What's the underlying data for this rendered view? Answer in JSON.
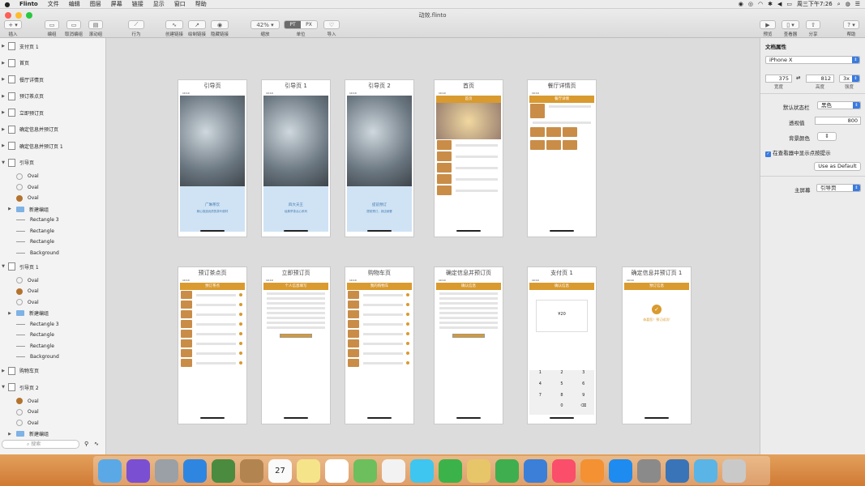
{
  "menubar": {
    "apple": "",
    "items": [
      "Flinto",
      "文件",
      "编辑",
      "图层",
      "屏幕",
      "链接",
      "显示",
      "窗口",
      "帮助"
    ],
    "clock": "周三下午7:26"
  },
  "window": {
    "title": "动效.flinto"
  },
  "toolbar": {
    "insert": "插入",
    "group": "编组",
    "ungroup": "取消编组",
    "scroll_group": "滚动组",
    "behavior": "行为",
    "create_link": "创建链接",
    "draw_link": "绘制链接",
    "hide_link": "隐藏链接",
    "zoom": "42%",
    "zoom_label": "缩放",
    "unit_pt": "PT",
    "unit_px": "PX",
    "unit_label": "单位",
    "import": "导入",
    "preview": "预览",
    "viewer": "查看器",
    "share": "分享",
    "help": "帮助"
  },
  "sidebar": {
    "screens_top": [
      "支付页 1",
      "首页",
      "餐厅详情页",
      "预订茶点页",
      "立即预订页",
      "确定信息并预订页",
      "确定信息并预订页 1"
    ],
    "guide": {
      "name": "引导页",
      "layers": [
        [
          "Oval",
          "oval-empty"
        ],
        [
          "Oval",
          "oval-empty"
        ],
        [
          "Oval",
          "oval-filled"
        ],
        [
          "新建编组",
          "group"
        ],
        [
          "Rectangle 3",
          "rect"
        ],
        [
          "Rectangle",
          "rect"
        ],
        [
          "Rectangle",
          "rect"
        ],
        [
          "Background",
          "rect"
        ]
      ]
    },
    "guide1": {
      "name": "引导页 1",
      "layers": [
        [
          "Oval",
          "oval-empty"
        ],
        [
          "Oval",
          "oval-filled"
        ],
        [
          "Oval",
          "oval-empty"
        ],
        [
          "新建编组",
          "group"
        ],
        [
          "Rectangle 3",
          "rect"
        ],
        [
          "Rectangle",
          "rect"
        ],
        [
          "Rectangle",
          "rect"
        ],
        [
          "Background",
          "rect"
        ]
      ]
    },
    "cart": "购物车页",
    "guide2": {
      "name": "引导页 2",
      "layers": [
        [
          "Oval",
          "oval-filled"
        ],
        [
          "Oval",
          "oval-empty"
        ],
        [
          "Oval",
          "oval-empty"
        ],
        [
          "新建编组",
          "group"
        ]
      ]
    },
    "search_placeholder": "搜索"
  },
  "frames": [
    {
      "title": "引导页",
      "kind": "guide",
      "caption": "广琳茶饮",
      "sub": "精心挑选优质的茶叶原材"
    },
    {
      "title": "引导页 1",
      "kind": "guide",
      "caption": "四大天王",
      "sub": "经典早茶点心系列"
    },
    {
      "title": "引导页 2",
      "kind": "guide",
      "caption": "提前预订",
      "sub": "提前预订，到店就餐"
    },
    {
      "title": "首页",
      "kind": "home",
      "header": "首页"
    },
    {
      "title": "餐厅详情页",
      "kind": "detail",
      "header": "餐厅详情"
    },
    {
      "title": "预订茶点页",
      "kind": "list",
      "header": "预订茶点"
    },
    {
      "title": "立即预订页",
      "kind": "form",
      "header": "个人信息填写"
    },
    {
      "title": "购物车页",
      "kind": "list",
      "header": "我的购物车"
    },
    {
      "title": "确定信息并预订页",
      "kind": "form",
      "header": "确认信息"
    },
    {
      "title": "支付页 1",
      "kind": "pay",
      "header": "确认信息",
      "amount": "¥20"
    },
    {
      "title": "确定信息并预订页 1",
      "kind": "done",
      "header": "预订信息",
      "msg": "恭喜您！预订成功!"
    }
  ],
  "inspector": {
    "section": "文档属性",
    "device": "iPhone X",
    "width": "375",
    "height": "812",
    "scale": "3x",
    "width_label": "宽度",
    "height_label": "高度",
    "scale_label": "强度",
    "status_bar_label": "默认状态栏",
    "status_bar": "黑色",
    "perspective_label": "透视值",
    "perspective": "800",
    "bg_color_label": "背景颜色",
    "touch_hint": "在查看器中显示点按提示",
    "use_default": "Use as Default",
    "home_label": "主屏幕",
    "home_screen": "引导页"
  },
  "dock": {
    "apps": [
      "finder-icon",
      "siri-icon",
      "launchpad-icon",
      "safari-icon",
      "photo-icon",
      "contacts-icon",
      "calendar-icon",
      "notes-icon",
      "reminders-icon",
      "maps-icon",
      "photos-icon",
      "messages-icon",
      "facetime-icon",
      "keynote-icon",
      "numbers-icon",
      "keynote2-icon",
      "music-icon",
      "books-icon",
      "appstore-icon",
      "prefs-icon",
      "flinto-icon",
      "folder-icon",
      "trash-icon"
    ],
    "calendar_day": "27"
  }
}
